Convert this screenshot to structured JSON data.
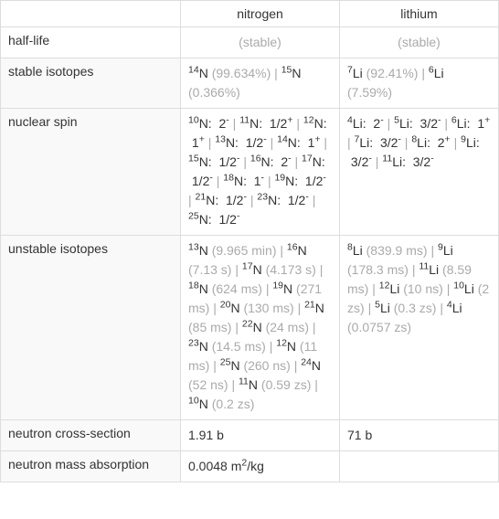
{
  "headers": {
    "col1": "",
    "col2": "nitrogen",
    "col3": "lithium"
  },
  "rows": [
    {
      "label": "half-life",
      "nitrogen_html": "<span class='gray'>(stable)</span>",
      "lithium_html": "<span class='gray'>(stable)</span>"
    },
    {
      "label": "stable isotopes",
      "nitrogen_html": "<sup>14</sup>N <span class='gray'>(99.634%)</span> <span class='gray'>|</span> <sup>15</sup>N <span class='gray'>(0.366%)</span>",
      "lithium_html": "<sup>7</sup>Li <span class='gray'>(92.41%)</span> <span class='gray'>|</span> <sup>6</sup>Li <span class='gray'>(7.59%)</span>"
    },
    {
      "label": "nuclear spin",
      "nitrogen_html": "<sup>10</sup>N: &nbsp;2<sup>-</sup> <span class='gray'>|</span> <sup>11</sup>N: &nbsp;1/2<sup>+</sup> <span class='gray'>|</span> <sup>12</sup>N: &nbsp;1<sup>+</sup> <span class='gray'>|</span> <sup>13</sup>N: &nbsp;1/2<sup>-</sup> <span class='gray'>|</span> <sup>14</sup>N: &nbsp;1<sup>+</sup> <span class='gray'>|</span> <sup>15</sup>N: &nbsp;1/2<sup>-</sup> <span class='gray'>|</span> <sup>16</sup>N: &nbsp;2<sup>-</sup> <span class='gray'>|</span> <sup>17</sup>N: &nbsp;1/2<sup>-</sup> <span class='gray'>|</span> <sup>18</sup>N: &nbsp;1<sup>-</sup> <span class='gray'>|</span> <sup>19</sup>N: &nbsp;1/2<sup>-</sup> <span class='gray'>|</span> <sup>21</sup>N: &nbsp;1/2<sup>-</sup> <span class='gray'>|</span> <sup>23</sup>N: &nbsp;1/2<sup>-</sup> <span class='gray'>|</span> <sup>25</sup>N: &nbsp;1/2<sup>-</sup>",
      "lithium_html": "<sup>4</sup>Li: &nbsp;2<sup>-</sup> <span class='gray'>|</span> <sup>5</sup>Li: &nbsp;3/2<sup>-</sup> <span class='gray'>|</span> <sup>6</sup>Li: &nbsp;1<sup>+</sup> <span class='gray'>|</span> <sup>7</sup>Li: &nbsp;3/2<sup>-</sup> <span class='gray'>|</span> <sup>8</sup>Li: &nbsp;2<sup>+</sup> <span class='gray'>|</span> <sup>9</sup>Li: &nbsp;3/2<sup>-</sup> <span class='gray'>|</span> <sup>11</sup>Li: &nbsp;3/2<sup>-</sup>"
    },
    {
      "label": "unstable isotopes",
      "nitrogen_html": "<sup>13</sup>N <span class='gray'>(9.965 min)</span> <span class='gray'>|</span> <sup>16</sup>N <span class='gray'>(7.13 s)</span> <span class='gray'>|</span> <sup>17</sup>N <span class='gray'>(4.173 s)</span> <span class='gray'>|</span> <sup>18</sup>N <span class='gray'>(624 ms)</span> <span class='gray'>|</span> <sup>19</sup>N <span class='gray'>(271 ms)</span> <span class='gray'>|</span> <sup>20</sup>N <span class='gray'>(130 ms)</span> <span class='gray'>|</span> <sup>21</sup>N <span class='gray'>(85 ms)</span> <span class='gray'>|</span> <sup>22</sup>N <span class='gray'>(24 ms)</span> <span class='gray'>|</span> <sup>23</sup>N <span class='gray'>(14.5 ms)</span> <span class='gray'>|</span> <sup>12</sup>N <span class='gray'>(11 ms)</span> <span class='gray'>|</span> <sup>25</sup>N <span class='gray'>(260 ns)</span> <span class='gray'>|</span> <sup>24</sup>N <span class='gray'>(52 ns)</span> <span class='gray'>|</span> <sup>11</sup>N <span class='gray'>(0.59 zs)</span> <span class='gray'>|</span> <sup>10</sup>N <span class='gray'>(0.2 zs)</span>",
      "lithium_html": "<sup>8</sup>Li <span class='gray'>(839.9 ms)</span> <span class='gray'>|</span> <sup>9</sup>Li <span class='gray'>(178.3 ms)</span> <span class='gray'>|</span> <sup>11</sup>Li <span class='gray'>(8.59 ms)</span> <span class='gray'>|</span> <sup>12</sup>Li <span class='gray'>(10 ns)</span> <span class='gray'>|</span> <sup>10</sup>Li <span class='gray'>(2 zs)</span> <span class='gray'>|</span> <sup>5</sup>Li <span class='gray'>(0.3 zs)</span> <span class='gray'>|</span> <sup>4</sup>Li <span class='gray'>(0.0757 zs)</span>"
    },
    {
      "label": "neutron cross-section",
      "nitrogen_html": "1.91 b",
      "lithium_html": "71 b"
    },
    {
      "label": "neutron mass absorption",
      "nitrogen_html": "0.0048 m<sup>2</sup>/kg",
      "lithium_html": ""
    }
  ],
  "chart_data": {
    "type": "table",
    "columns": [
      "property",
      "nitrogen",
      "lithium"
    ],
    "rows": [
      {
        "property": "half-life",
        "nitrogen": "(stable)",
        "lithium": "(stable)"
      },
      {
        "property": "stable isotopes",
        "nitrogen": "14N (99.634%) | 15N (0.366%)",
        "lithium": "7Li (92.41%) | 6Li (7.59%)"
      },
      {
        "property": "nuclear spin",
        "nitrogen": "10N: 2- | 11N: 1/2+ | 12N: 1+ | 13N: 1/2- | 14N: 1+ | 15N: 1/2- | 16N: 2- | 17N: 1/2- | 18N: 1- | 19N: 1/2- | 21N: 1/2- | 23N: 1/2- | 25N: 1/2-",
        "lithium": "4Li: 2- | 5Li: 3/2- | 6Li: 1+ | 7Li: 3/2- | 8Li: 2+ | 9Li: 3/2- | 11Li: 3/2-"
      },
      {
        "property": "unstable isotopes",
        "nitrogen": "13N (9.965 min) | 16N (7.13 s) | 17N (4.173 s) | 18N (624 ms) | 19N (271 ms) | 20N (130 ms) | 21N (85 ms) | 22N (24 ms) | 23N (14.5 ms) | 12N (11 ms) | 25N (260 ns) | 24N (52 ns) | 11N (0.59 zs) | 10N (0.2 zs)",
        "lithium": "8Li (839.9 ms) | 9Li (178.3 ms) | 11Li (8.59 ms) | 12Li (10 ns) | 10Li (2 zs) | 5Li (0.3 zs) | 4Li (0.0757 zs)"
      },
      {
        "property": "neutron cross-section",
        "nitrogen": "1.91 b",
        "lithium": "71 b"
      },
      {
        "property": "neutron mass absorption",
        "nitrogen": "0.0048 m2/kg",
        "lithium": ""
      }
    ]
  }
}
